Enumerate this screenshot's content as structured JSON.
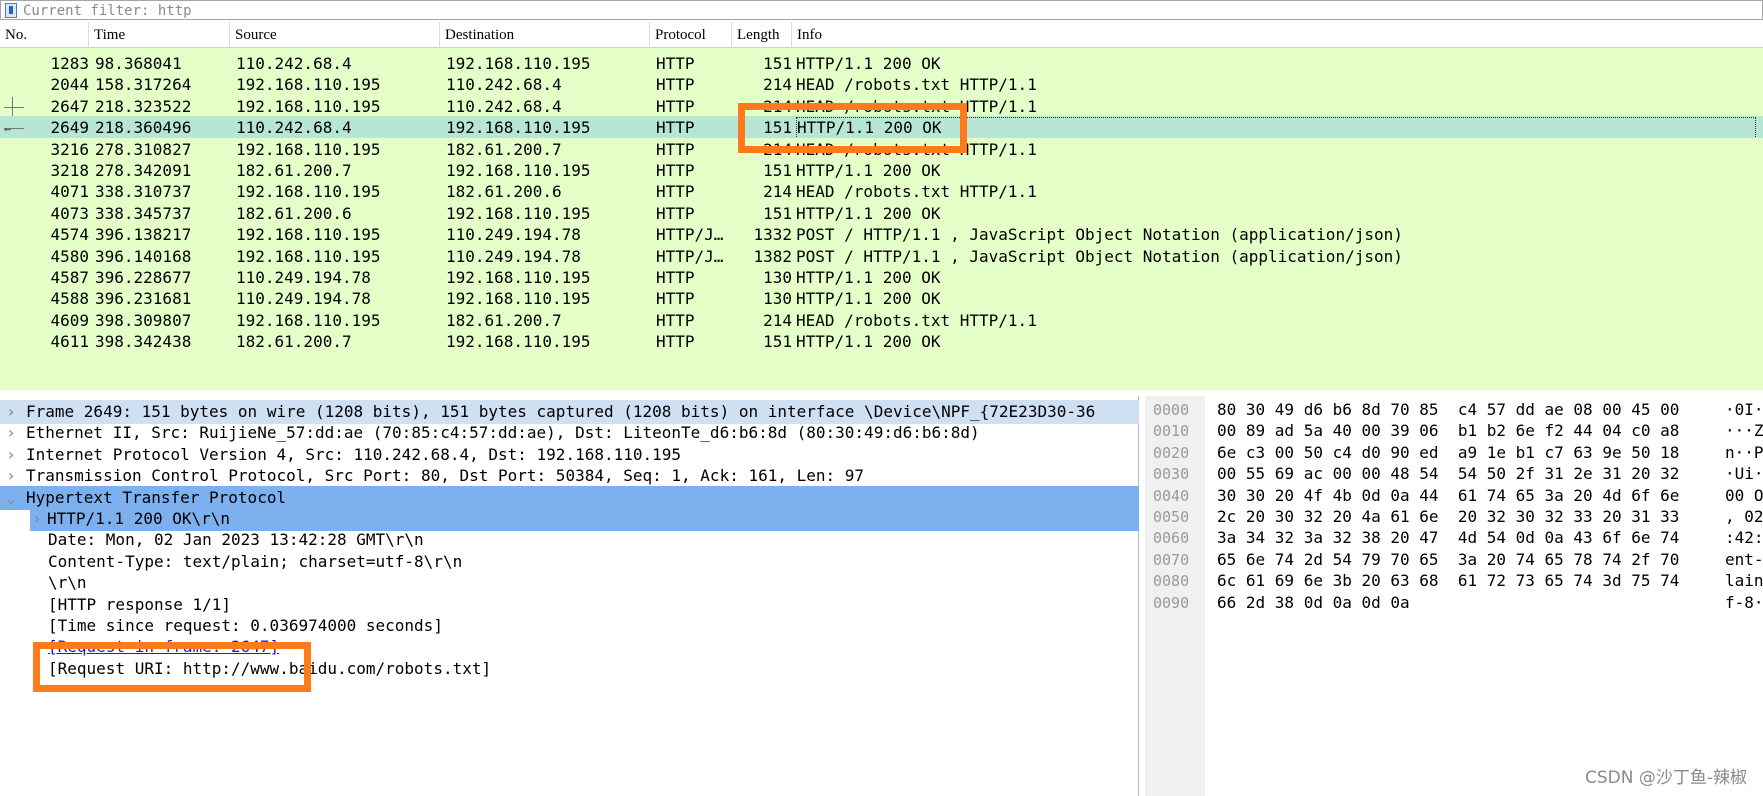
{
  "filter": {
    "placeholder": "Current filter: http"
  },
  "packet_list": {
    "columns": [
      "No.",
      "Time",
      "Source",
      "Destination",
      "Protocol",
      "Length",
      "Info"
    ],
    "rows": [
      {
        "no": "1283",
        "time": "98.368041",
        "src": "110.242.68.4",
        "dst": "192.168.110.195",
        "proto": "HTTP",
        "len": "151",
        "info": "HTTP/1.1 200 OK"
      },
      {
        "no": "2044",
        "time": "158.317264",
        "src": "192.168.110.195",
        "dst": "110.242.68.4",
        "proto": "HTTP",
        "len": "214",
        "info": "HEAD /robots.txt HTTP/1.1"
      },
      {
        "no": "2647",
        "time": "218.323522",
        "src": "192.168.110.195",
        "dst": "110.242.68.4",
        "proto": "HTTP",
        "len": "214",
        "info": "HEAD /robots.txt HTTP/1.1"
      },
      {
        "no": "2649",
        "time": "218.360496",
        "src": "110.242.68.4",
        "dst": "192.168.110.195",
        "proto": "HTTP",
        "len": "151",
        "info": "HTTP/1.1 200 OK"
      },
      {
        "no": "3216",
        "time": "278.310827",
        "src": "192.168.110.195",
        "dst": "182.61.200.7",
        "proto": "HTTP",
        "len": "214",
        "info": "HEAD /robots.txt HTTP/1.1"
      },
      {
        "no": "3218",
        "time": "278.342091",
        "src": "182.61.200.7",
        "dst": "192.168.110.195",
        "proto": "HTTP",
        "len": "151",
        "info": "HTTP/1.1 200 OK"
      },
      {
        "no": "4071",
        "time": "338.310737",
        "src": "192.168.110.195",
        "dst": "182.61.200.6",
        "proto": "HTTP",
        "len": "214",
        "info": "HEAD /robots.txt HTTP/1.1"
      },
      {
        "no": "4073",
        "time": "338.345737",
        "src": "182.61.200.6",
        "dst": "192.168.110.195",
        "proto": "HTTP",
        "len": "151",
        "info": "HTTP/1.1 200 OK"
      },
      {
        "no": "4574",
        "time": "396.138217",
        "src": "192.168.110.195",
        "dst": "110.249.194.78",
        "proto": "HTTP/J…",
        "len": "1332",
        "info": "POST / HTTP/1.1 , JavaScript Object Notation (application/json)"
      },
      {
        "no": "4580",
        "time": "396.140168",
        "src": "192.168.110.195",
        "dst": "110.249.194.78",
        "proto": "HTTP/J…",
        "len": "1382",
        "info": "POST / HTTP/1.1 , JavaScript Object Notation (application/json)"
      },
      {
        "no": "4587",
        "time": "396.228677",
        "src": "110.249.194.78",
        "dst": "192.168.110.195",
        "proto": "HTTP",
        "len": "130",
        "info": "HTTP/1.1 200 OK"
      },
      {
        "no": "4588",
        "time": "396.231681",
        "src": "110.249.194.78",
        "dst": "192.168.110.195",
        "proto": "HTTP",
        "len": "130",
        "info": "HTTP/1.1 200 OK"
      },
      {
        "no": "4609",
        "time": "398.309807",
        "src": "192.168.110.195",
        "dst": "182.61.200.7",
        "proto": "HTTP",
        "len": "214",
        "info": "HEAD /robots.txt HTTP/1.1"
      },
      {
        "no": "4611",
        "time": "398.342438",
        "src": "182.61.200.7",
        "dst": "192.168.110.195",
        "proto": "HTTP",
        "len": "151",
        "info": "HTTP/1.1 200 OK"
      }
    ]
  },
  "detail": {
    "lines": [
      {
        "text": "Frame 2649: 151 bytes on wire (1208 bits), 151 bytes captured (1208 bits) on interface \\Device\\NPF_{72E23D30-36",
        "twisty": ">"
      },
      {
        "text": "Ethernet II, Src: RuijieNe_57:dd:ae (70:85:c4:57:dd:ae), Dst: LiteonTe_d6:b6:8d (80:30:49:d6:b6:8d)",
        "twisty": ">"
      },
      {
        "text": "Internet Protocol Version 4, Src: 110.242.68.4, Dst: 192.168.110.195",
        "twisty": ">"
      },
      {
        "text": "Transmission Control Protocol, Src Port: 80, Dst Port: 50384, Seq: 1, Ack: 161, Len: 97",
        "twisty": ">"
      },
      {
        "text": "Hypertext Transfer Protocol",
        "twisty": "v"
      },
      {
        "text": "HTTP/1.1 200 OK\\r\\n",
        "twisty": ">"
      },
      {
        "text": "Date: Mon, 02 Jan 2023 13:42:28 GMT\\r\\n",
        "twisty": ""
      },
      {
        "text": "Content-Type: text/plain; charset=utf-8\\r\\n",
        "twisty": ""
      },
      {
        "text": "\\r\\n",
        "twisty": ""
      },
      {
        "text": "[HTTP response 1/1]",
        "twisty": ""
      },
      {
        "text": "[Time since request: 0.036974000 seconds]",
        "twisty": ""
      },
      {
        "text": "[Request in frame: 2647]",
        "twisty": ""
      },
      {
        "text": "[Request URI: http://www.baidu.com/robots.txt]",
        "twisty": ""
      }
    ]
  },
  "hex": {
    "rows": [
      {
        "off": "0000",
        "bytes": "80 30 49 d6 b6 8d 70 85  c4 57 dd ae 08 00 45 00",
        "ascii": "·0I·"
      },
      {
        "off": "0010",
        "bytes": "00 89 ad 5a 40 00 39 06  b1 b2 6e f2 44 04 c0 a8",
        "ascii": "···Z"
      },
      {
        "off": "0020",
        "bytes": "6e c3 00 50 c4 d0 90 ed  a9 1e b1 c7 63 9e 50 18",
        "ascii": "n··P"
      },
      {
        "off": "0030",
        "bytes": "00 55 69 ac 00 00 48 54  54 50 2f 31 2e 31 20 32",
        "ascii": "·Ui·"
      },
      {
        "off": "0040",
        "bytes": "30 30 20 4f 4b 0d 0a 44  61 74 65 3a 20 4d 6f 6e",
        "ascii": "00 O"
      },
      {
        "off": "0050",
        "bytes": "2c 20 30 32 20 4a 61 6e  20 32 30 32 33 20 31 33",
        "ascii": ", 02"
      },
      {
        "off": "0060",
        "bytes": "3a 34 32 3a 32 38 20 47  4d 54 0d 0a 43 6f 6e 74",
        "ascii": ":42:"
      },
      {
        "off": "0070",
        "bytes": "65 6e 74 2d 54 79 70 65  3a 20 74 65 78 74 2f 70",
        "ascii": "ent-"
      },
      {
        "off": "0080",
        "bytes": "6c 61 69 6e 3b 20 63 68  61 72 73 65 74 3d 75 74",
        "ascii": "lain"
      },
      {
        "off": "0090",
        "bytes": "66 2d 38 0d 0a 0d 0a",
        "ascii": "f-8·"
      }
    ]
  },
  "watermark": "CSDN @沙丁鱼-辣椒",
  "colors": {
    "row_bg": "#e4ffc7",
    "selected_row_bg": "#b8e6d4",
    "detail_frame_bg": "#cfe0f3",
    "detail_selected_bg": "#7cb0ee",
    "annotation": "#ff7a1a"
  }
}
